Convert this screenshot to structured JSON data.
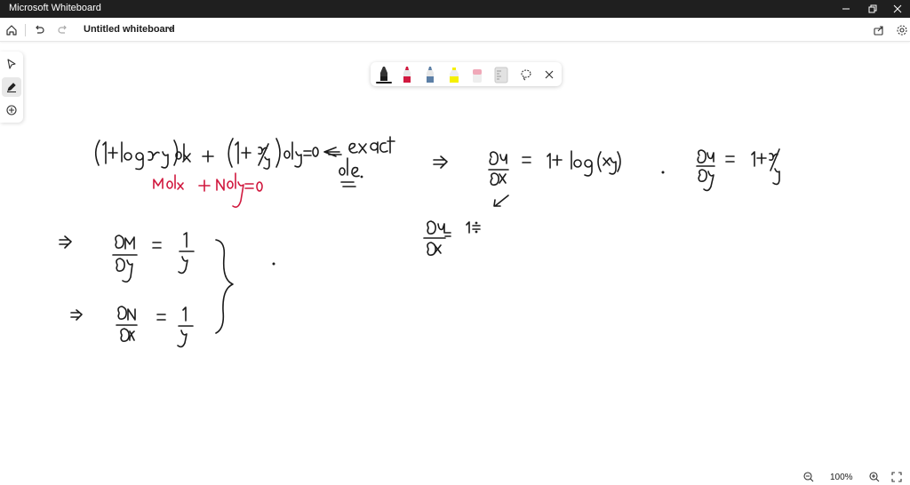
{
  "window": {
    "app_title": "Microsoft Whiteboard"
  },
  "header": {
    "board_title": "Untitled whiteboard"
  },
  "left_toolbar": {
    "tools": [
      "select-icon",
      "pen-icon",
      "add-icon"
    ],
    "active": "pen-icon"
  },
  "pen_tray": {
    "pens": [
      {
        "name": "black-pen",
        "color": "#1b1b1b",
        "selected": true
      },
      {
        "name": "red-pen",
        "color": "#d1193f"
      },
      {
        "name": "blue-pen",
        "color": "#5c7fa6"
      },
      {
        "name": "highlighter",
        "color": "#f5f000"
      },
      {
        "name": "eraser",
        "color": "#f0a8b8"
      },
      {
        "name": "ruler",
        "color": "#c8c8c8"
      }
    ],
    "extra": [
      "lasso-icon",
      "close-icon"
    ]
  },
  "zoom": {
    "level": "100%"
  },
  "colors": {
    "titlebar": "#1f1f1f",
    "ink_black": "#1b1b1b",
    "ink_red": "#d1193f"
  }
}
